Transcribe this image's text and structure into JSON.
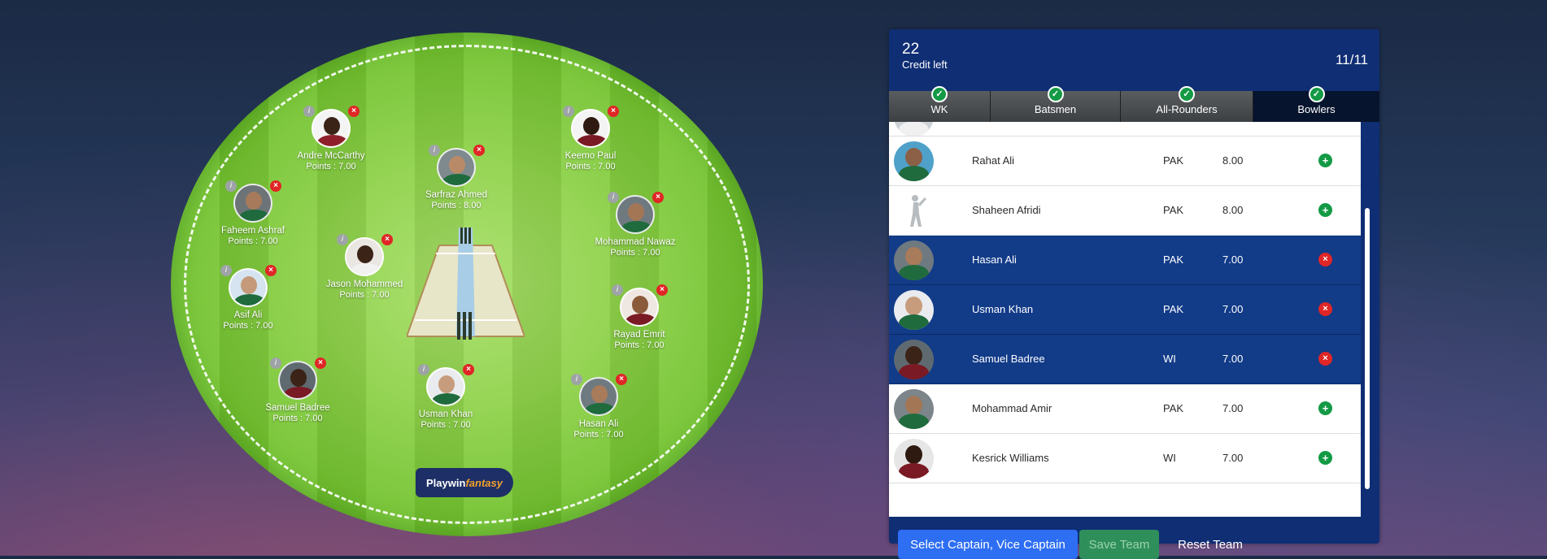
{
  "team": {
    "credit_value": "22",
    "credit_label": "Credit left",
    "player_count": "11/11"
  },
  "tabs": [
    {
      "label": "WK",
      "complete": true
    },
    {
      "label": "Batsmen",
      "complete": true
    },
    {
      "label": "All-Rounders",
      "complete": true
    },
    {
      "label": "Bowlers",
      "complete": true,
      "active": true
    }
  ],
  "field": {
    "brand_part1": "Playwin",
    "brand_part2": "fantasy",
    "players": [
      {
        "name": "Andre McCarthy",
        "points": "Points : 7.00"
      },
      {
        "name": "Keemo Paul",
        "points": "Points : 7.00"
      },
      {
        "name": "Sarfraz Ahmed",
        "points": "Points : 8.00"
      },
      {
        "name": "Faheem Ashraf",
        "points": "Points : 7.00"
      },
      {
        "name": "Mohammad Nawaz",
        "points": "Points : 7.00"
      },
      {
        "name": "Jason Mohammed",
        "points": "Points : 7.00"
      },
      {
        "name": "Asif Ali",
        "points": "Points : 7.00"
      },
      {
        "name": "Rayad Emrit",
        "points": "Points : 7.00"
      },
      {
        "name": "Samuel Badree",
        "points": "Points : 7.00"
      },
      {
        "name": "Usman Khan",
        "points": "Points : 7.00"
      },
      {
        "name": "Hasan Ali",
        "points": "Points : 7.00"
      }
    ]
  },
  "bowlers": [
    {
      "name": "Rahat Ali",
      "team": "PAK",
      "credit": "8.00",
      "selected": false
    },
    {
      "name": "Shaheen Afridi",
      "team": "PAK",
      "credit": "8.00",
      "selected": false
    },
    {
      "name": "Hasan Ali",
      "team": "PAK",
      "credit": "7.00",
      "selected": true
    },
    {
      "name": "Usman Khan",
      "team": "PAK",
      "credit": "7.00",
      "selected": true
    },
    {
      "name": "Samuel Badree",
      "team": "WI",
      "credit": "7.00",
      "selected": true
    },
    {
      "name": "Mohammad Amir",
      "team": "PAK",
      "credit": "7.00",
      "selected": false
    },
    {
      "name": "Kesrick Williams",
      "team": "WI",
      "credit": "7.00",
      "selected": false
    }
  ],
  "actions": {
    "captain_label": "Select Captain, Vice Captain",
    "save_label": "Save Team",
    "reset_label": "Reset Team"
  },
  "icons": {
    "info": "i",
    "remove": "×",
    "add": "+",
    "check": "✓"
  },
  "colors": {
    "panel_bg": "#0f2e74",
    "selected_row": "#123b88",
    "add_green": "#139a45",
    "remove_red": "#e02626",
    "captain_button": "#2d6ef2",
    "save_button": "#2f8f5a"
  }
}
